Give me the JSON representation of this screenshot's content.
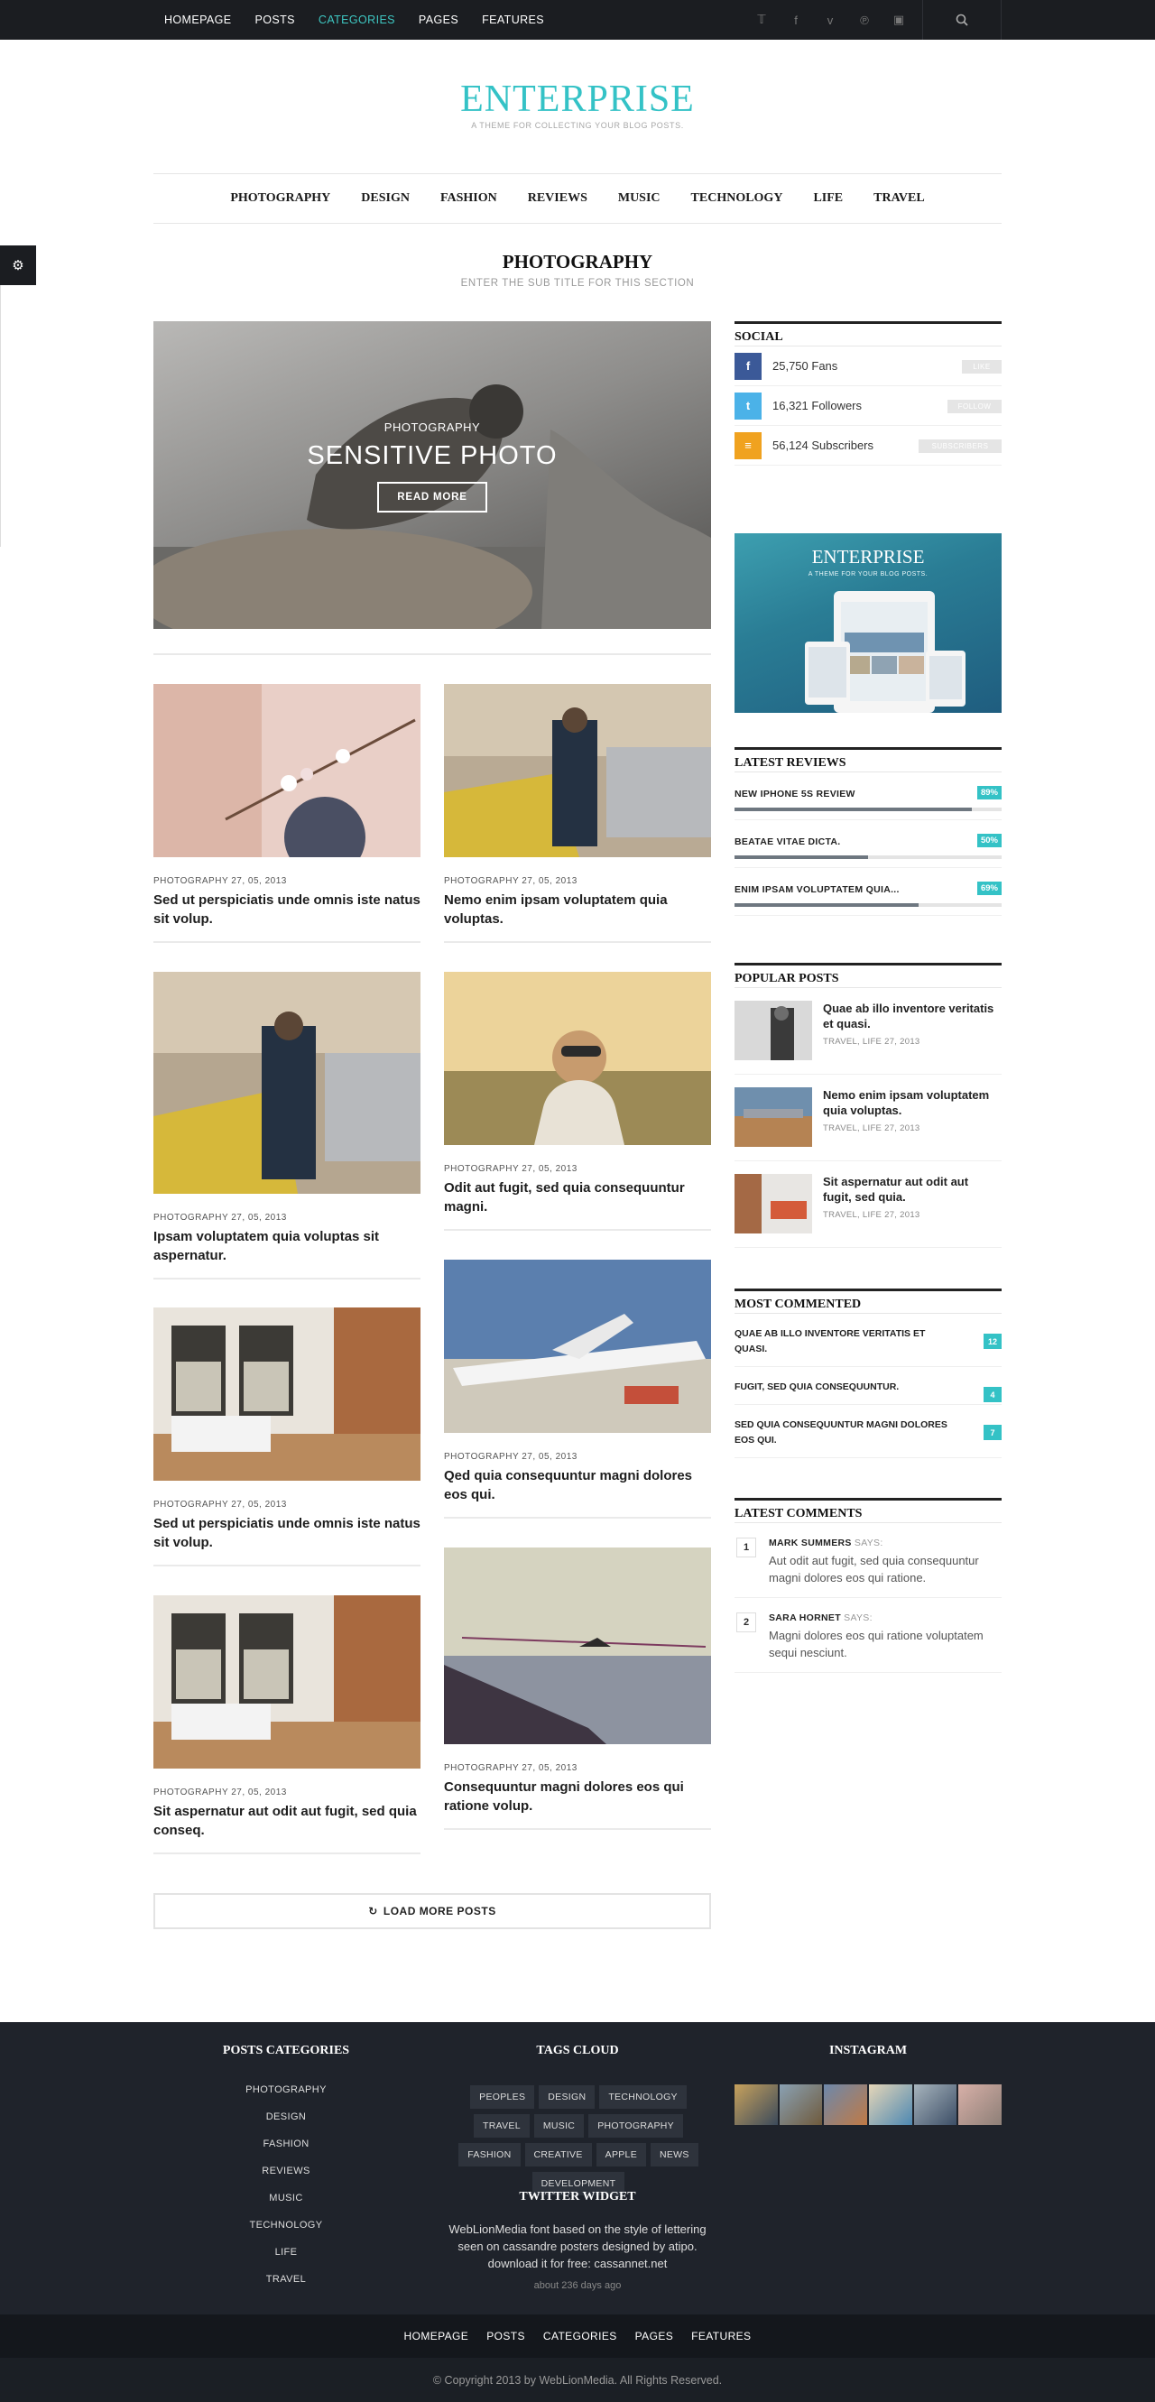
{
  "topbar": {
    "menu": [
      "HOMEPAGE",
      "POSTS",
      "CATEGORIES",
      "PAGES",
      "FEATURES"
    ],
    "social_icons": [
      "twitter-icon",
      "facebook-icon",
      "vimeo-icon",
      "pinterest-icon",
      "instagram-icon"
    ]
  },
  "logo": {
    "name": "ENTERPRISE",
    "tagline": "A THEME FOR COLLECTING YOUR BLOG POSTS."
  },
  "mainnav": [
    "PHOTOGRAPHY",
    "DESIGN",
    "FASHION",
    "REVIEWS",
    "MUSIC",
    "TECHNOLOGY",
    "LIFE",
    "TRAVEL"
  ],
  "section": {
    "title": "PHOTOGRAPHY",
    "subtitle": "ENTER THE SUB TITLE FOR THIS SECTION"
  },
  "hero": {
    "category": "PHOTOGRAPHY",
    "title": "SENSITIVE PHOTO",
    "button": "READ MORE"
  },
  "posts": [
    {
      "meta": "PHOTOGRAPHY 27, 05, 2013",
      "title": "Sed ut perspiciatis unde omnis iste natus sit volup."
    },
    {
      "meta": "PHOTOGRAPHY 27, 05, 2013",
      "title": "Nemo enim ipsam voluptatem quia voluptas."
    },
    {
      "meta": "PHOTOGRAPHY 27, 05, 2013",
      "title": "Ipsam voluptatem quia voluptas sit aspernatur."
    },
    {
      "meta": "PHOTOGRAPHY 27, 05, 2013",
      "title": "Odit aut fugit, sed quia consequuntur magni."
    },
    {
      "meta": "PHOTOGRAPHY 27, 05, 2013",
      "title": "Sed ut perspiciatis unde omnis iste natus sit volup."
    },
    {
      "meta": "PHOTOGRAPHY 27, 05, 2013",
      "title": "Qed quia consequuntur magni dolores eos qui."
    },
    {
      "meta": "PHOTOGRAPHY 27, 05, 2013",
      "title": "Sit aspernatur aut odit aut fugit, sed quia conseq."
    },
    {
      "meta": "PHOTOGRAPHY 27, 05, 2013",
      "title": "Consequuntur magni dolores eos qui ratione volup."
    }
  ],
  "load_more": "LOAD MORE POSTS",
  "social": {
    "title": "SOCIAL",
    "rows": [
      {
        "label": "25,750 Fans",
        "button": "LIKE",
        "color": "#3b5998"
      },
      {
        "label": "16,321 Followers",
        "button": "FOLLOW",
        "color": "#4bb2e8"
      },
      {
        "label": "56,124 Subscribers",
        "button": "SUBSCRIBERS",
        "color": "#f0a21f"
      }
    ]
  },
  "ad": {
    "name": "ENTERPRISE",
    "tagline": "A THEME FOR YOUR BLOG POSTS."
  },
  "reviews": {
    "title": "LATEST REVIEWS",
    "items": [
      {
        "label": "NEW IPHONE 5S REVIEW",
        "percent": "89%",
        "value": 89
      },
      {
        "label": "BEATAE VITAE DICTA.",
        "percent": "50%",
        "value": 50
      },
      {
        "label": "ENIM IPSAM VOLUPTATEM QUIA...",
        "percent": "69%",
        "value": 69
      }
    ]
  },
  "popular": {
    "title": "POPULAR POSTS",
    "items": [
      {
        "title": "Quae ab illo inventore veritatis et quasi.",
        "meta": "TRAVEL, LIFE 27, 2013"
      },
      {
        "title": "Nemo enim ipsam voluptatem quia voluptas.",
        "meta": "TRAVEL, LIFE 27, 2013"
      },
      {
        "title": "Sit aspernatur aut odit aut fugit, sed quia.",
        "meta": "TRAVEL, LIFE 27, 2013"
      }
    ]
  },
  "most_commented": {
    "title": "MOST COMMENTED",
    "items": [
      {
        "title": "QUAE AB ILLO INVENTORE VERITATIS ET QUASI.",
        "count": "12"
      },
      {
        "title": "FUGIT, SED QUIA CONSEQUUNTUR.",
        "count": "4"
      },
      {
        "title": "SED QUIA CONSEQUUNTUR MAGNI DOLORES EOS QUI.",
        "count": "7"
      }
    ]
  },
  "latest_comments": {
    "title": "LATEST COMMENTS",
    "says": "SAYS:",
    "items": [
      {
        "num": "1",
        "author": "MARK SUMMERS",
        "text": "Aut odit aut fugit, sed quia consequuntur magni dolores eos qui ratione."
      },
      {
        "num": "2",
        "author": "SARA HORNET",
        "text": "Magni dolores eos qui ratione voluptatem sequi nesciunt."
      }
    ]
  },
  "footer": {
    "categories_title": "POSTS CATEGORIES",
    "categories": [
      "PHOTOGRAPHY",
      "DESIGN",
      "FASHION",
      "REVIEWS",
      "MUSIC",
      "TECHNOLOGY",
      "LIFE",
      "TRAVEL"
    ],
    "tags_title": "TAGS CLOUD",
    "tags": [
      "PEOPLES",
      "DESIGN",
      "TECHNOLOGY",
      "TRAVEL",
      "MUSIC",
      "PHOTOGRAPHY",
      "FASHION",
      "CREATIVE",
      "APPLE",
      "NEWS",
      "DEVELOPMENT"
    ],
    "twitter_title": "TWITTER WIDGET",
    "tweet": "WebLionMedia font based on the style of lettering seen on cassandre posters designed by atipo. download it for free: cassannet.net",
    "tweet_ago": "about 236 days ago",
    "instagram_title": "INSTAGRAM"
  },
  "bottom_nav": [
    "HOMEPAGE",
    "POSTS",
    "CATEGORIES",
    "PAGES",
    "FEATURES"
  ],
  "copyright": "© Copyright 2013 by WebLionMedia. All Rights Reserved."
}
